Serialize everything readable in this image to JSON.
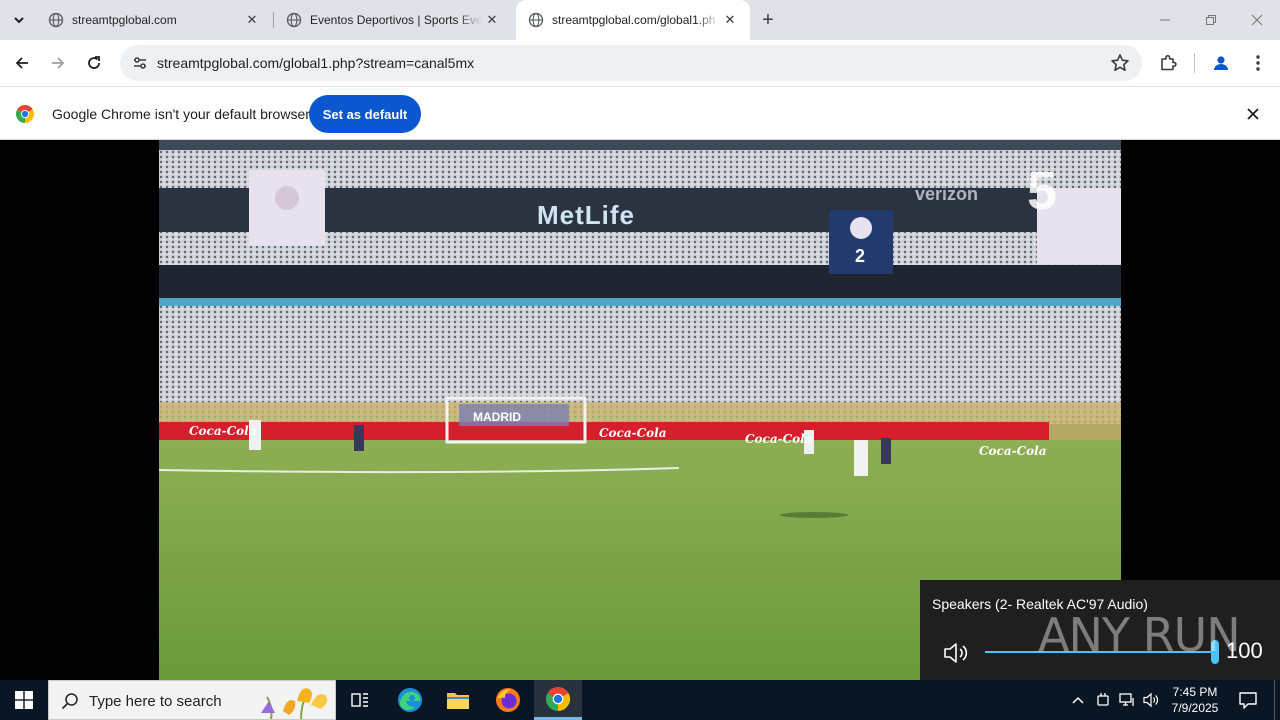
{
  "browser": {
    "tabs": [
      {
        "title": "streamtpglobal.com",
        "active": false
      },
      {
        "title": "Eventos Deportivos | Sports Eve",
        "active": false
      },
      {
        "title": "streamtpglobal.com/global1.ph",
        "active": true
      }
    ],
    "url": "streamtpglobal.com/global1.php?stream=canal5mx"
  },
  "infobar": {
    "message": "Google Chrome isn't your default browser",
    "button_label": "Set as default"
  },
  "video": {
    "sponsors": [
      "MetLife",
      "verizon",
      "Coca-Cola",
      "MADRID"
    ],
    "scoreboard_number": "2",
    "channel_logo": "5"
  },
  "volume": {
    "device": "Speakers (2- Realtek AC'97 Audio)",
    "level": "100",
    "watermark": "ANY RUN"
  },
  "taskbar": {
    "search_placeholder": "Type here to search",
    "time": "7:45 PM",
    "date": "7/9/2025"
  },
  "colors": {
    "accent": "#0b57d0",
    "volume_accent": "#4cc2ff",
    "taskbar": "#0a1624"
  }
}
